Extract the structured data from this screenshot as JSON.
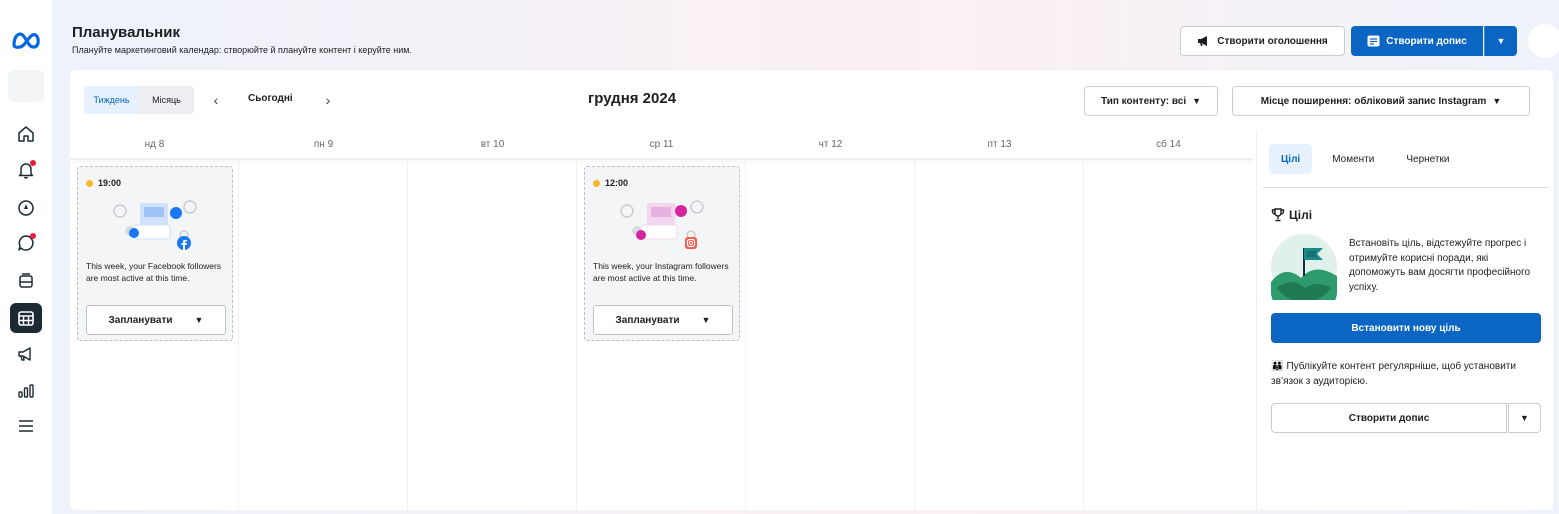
{
  "header": {
    "title": "Планувальник",
    "subtitle": "Плануйте маркетинговий календар: створюйте й плануйте контент і керуйте ним.",
    "create_ad_label": "Створити оголошення",
    "create_post_label": "Створити допис"
  },
  "toolbar": {
    "view_week": "Тиждень",
    "view_month": "Місяць",
    "today_label": "Сьогодні",
    "period_title": "грудня 2024",
    "content_type_filter": "Тип контенту: всі",
    "placement_filter": "Місце поширення: обліковий запис Instagram"
  },
  "days": [
    {
      "label": "нд 8"
    },
    {
      "label": "пн 9"
    },
    {
      "label": "вт 10"
    },
    {
      "label": "ср 11"
    },
    {
      "label": "чт 12"
    },
    {
      "label": "пт 13"
    },
    {
      "label": "сб 14"
    }
  ],
  "cards": [
    {
      "time": "19:00",
      "message": "This week, your Facebook followers are most active at this time.",
      "schedule_label": "Запланувати",
      "network": "facebook",
      "accent": "#1877f2"
    },
    {
      "time": "12:00",
      "message": "This week, your Instagram followers are most active at this time.",
      "schedule_label": "Запланувати",
      "network": "instagram",
      "accent": "#d6249f"
    }
  ],
  "sidebar": {
    "tabs": [
      "Цілі",
      "Моменти",
      "Чернетки"
    ],
    "goals_title": "Цілі",
    "goals_text": "Встановіть ціль, відстежуйте прогрес і отримуйте корисні поради, які допоможуть вам досягти професійного успіху.",
    "new_goal_button": "Встановити нову ціль",
    "tip_text": "Публікуйте контент регулярніше, щоб установити зв’язок з аудиторією.",
    "create_post_button": "Створити допис"
  },
  "colors": {
    "primary": "#0a66c2",
    "nav_active": "#1c2b33",
    "notification": "#e41e3f",
    "time_dot": "#f7b928"
  },
  "icons": {
    "nav": [
      "home-icon",
      "notifications-icon",
      "compass-icon",
      "messages-icon",
      "content-icon",
      "planner-icon",
      "ads-icon",
      "insights-icon",
      "menu-icon"
    ]
  }
}
